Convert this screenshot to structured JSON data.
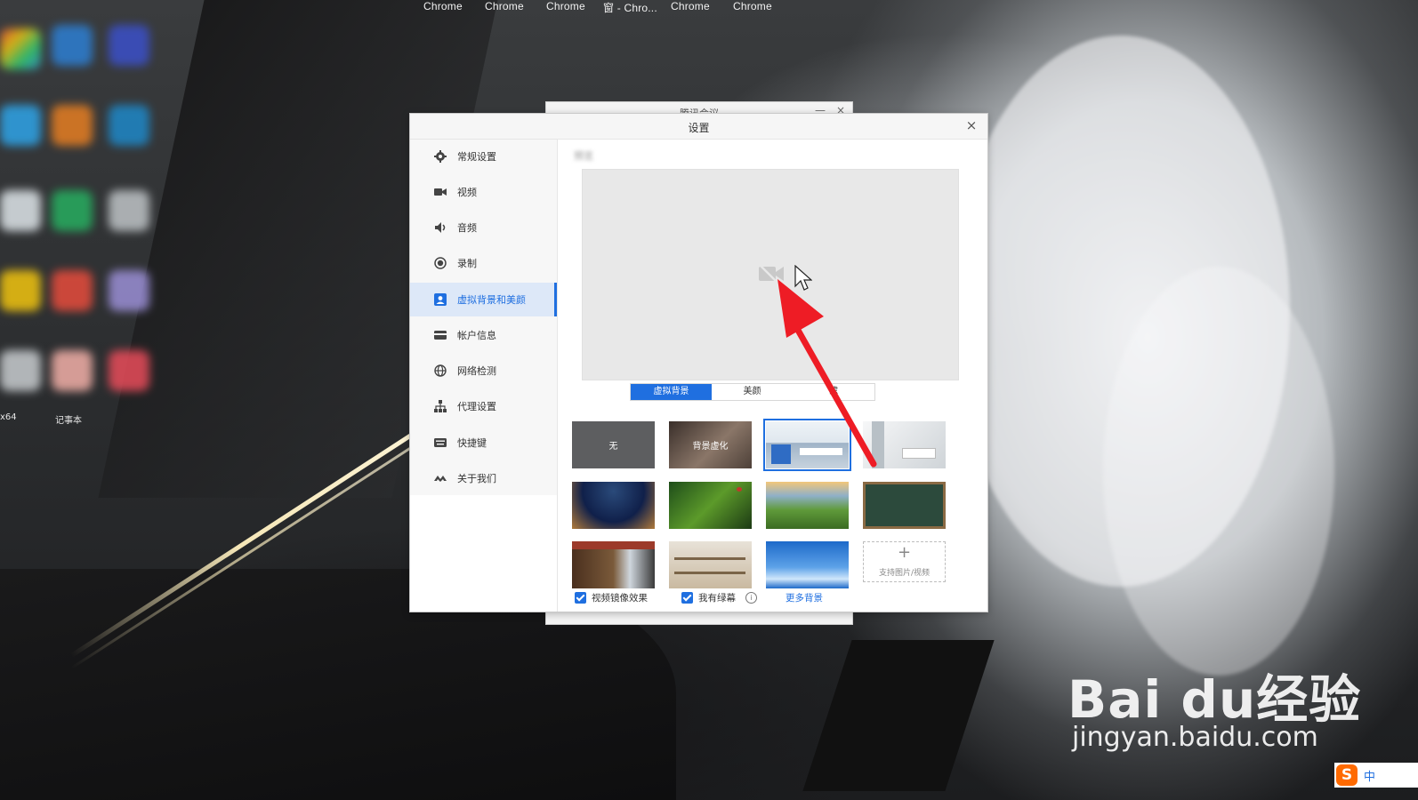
{
  "desktop": {
    "taskbar_items": [
      "Chrome",
      "Chrome",
      "Chrome",
      "窗 - Chro...",
      "Chrome",
      "Chrome"
    ],
    "icon_labels": [
      "x64",
      "记事本"
    ]
  },
  "behind_window": {
    "title": "腾讯会议"
  },
  "settings_dialog": {
    "title": "设置",
    "close_label": "×",
    "sidebar": {
      "items": [
        {
          "label": "常规设置",
          "icon": "gear-icon"
        },
        {
          "label": "视频",
          "icon": "video-camera-icon"
        },
        {
          "label": "音频",
          "icon": "speaker-icon"
        },
        {
          "label": "录制",
          "icon": "record-icon"
        },
        {
          "label": "虚拟背景和美颜",
          "icon": "portrait-icon",
          "active": true
        },
        {
          "label": "帐户信息",
          "icon": "card-icon"
        },
        {
          "label": "网络检测",
          "icon": "globe-icon"
        },
        {
          "label": "代理设置",
          "icon": "network-tree-icon"
        },
        {
          "label": "快捷键",
          "icon": "keyboard-icon"
        },
        {
          "label": "关于我们",
          "icon": "logo-icon"
        }
      ]
    },
    "content": {
      "tabs": [
        {
          "label": "虚拟背景",
          "active": true
        },
        {
          "label": "美颜"
        },
        {
          "label": "滤"
        }
      ],
      "backgrounds": [
        {
          "label": "无",
          "kind": "none"
        },
        {
          "label": "背景虚化",
          "kind": "blur"
        },
        {
          "kind": "office",
          "selected": true
        },
        {
          "kind": "room"
        },
        {
          "kind": "star-trails"
        },
        {
          "kind": "leaf"
        },
        {
          "kind": "hills"
        },
        {
          "kind": "chalkboard"
        },
        {
          "kind": "bookshelf"
        },
        {
          "kind": "shelves"
        },
        {
          "kind": "sky"
        }
      ],
      "add_background_label": "支持图片/视频",
      "add_icon": "+",
      "mirror_label": "视频镜像效果",
      "mirror_checked": true,
      "greenscreen_label": "我有绿幕",
      "greenscreen_checked": true,
      "info_glyph": "i",
      "more_backgrounds_label": "更多背景"
    }
  },
  "colors": {
    "accent": "#1f6fe0",
    "arrow": "#ee1c25"
  },
  "watermark": {
    "brand": "Bai du经验",
    "url": "jingyan.baidu.com"
  },
  "tray": {
    "ime_logo": "S",
    "ime_mode": "中"
  }
}
